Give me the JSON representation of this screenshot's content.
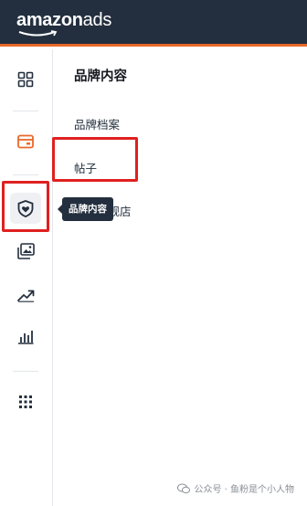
{
  "header": {
    "logo_brand": "amazon",
    "logo_suffix": "ads",
    "accent_color": "#e8692b",
    "bg_color": "#232f3e"
  },
  "rail": {
    "items": [
      {
        "icon": "dashboard-icon"
      },
      {
        "icon": "campaign-card-icon",
        "color": "#e8692b"
      },
      {
        "icon": "brand-shield-icon",
        "active": true
      },
      {
        "icon": "media-library-icon"
      },
      {
        "icon": "trend-chart-icon"
      },
      {
        "icon": "bar-chart-icon"
      },
      {
        "icon": "apps-grid-icon"
      }
    ]
  },
  "panel": {
    "title": "品牌内容",
    "items": [
      {
        "label": "品牌档案"
      },
      {
        "label": "帖子"
      },
      {
        "label": "品牌旗舰店"
      }
    ]
  },
  "tooltip": {
    "text": "品牌内容"
  },
  "highlight_color": "#e02020",
  "watermark": {
    "text": "公众号 · 鱼粉是个小人物"
  }
}
